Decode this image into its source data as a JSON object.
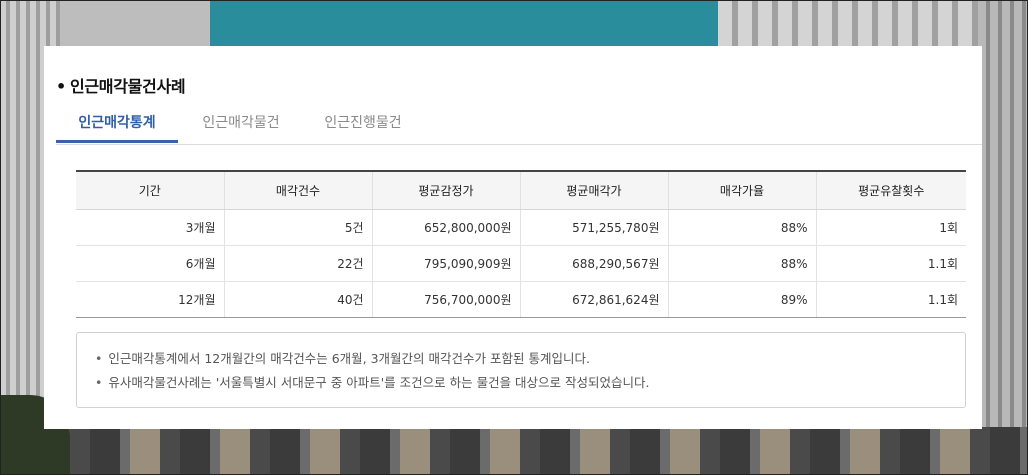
{
  "section": {
    "bullet": "•",
    "title": "인근매각물건사례"
  },
  "tabs": [
    {
      "label": "인근매각통계"
    },
    {
      "label": "인근매각물건"
    },
    {
      "label": "인근진행물건"
    }
  ],
  "table": {
    "headers": [
      "기간",
      "매각건수",
      "평균감정가",
      "평균매각가",
      "매각가율",
      "평균유찰횟수"
    ],
    "rows": [
      [
        "3개월",
        "5건",
        "652,800,000원",
        "571,255,780원",
        "88%",
        "1회"
      ],
      [
        "6개월",
        "22건",
        "795,090,909원",
        "688,290,567원",
        "88%",
        "1.1회"
      ],
      [
        "12개월",
        "40건",
        "756,700,000원",
        "672,861,624원",
        "89%",
        "1.1회"
      ]
    ]
  },
  "notes": [
    "인근매각통계에서 12개월간의 매각건수는 6개월, 3개월간의 매각건수가 포함된 통계입니다.",
    "유사매각물건사례는 '서울특별시 서대문구 중 아파트'를 조건으로 하는 물건을 대상으로 작성되었습니다."
  ],
  "colors": {
    "active_tab": "#2f5fa8",
    "table_top_border": "#444444"
  }
}
